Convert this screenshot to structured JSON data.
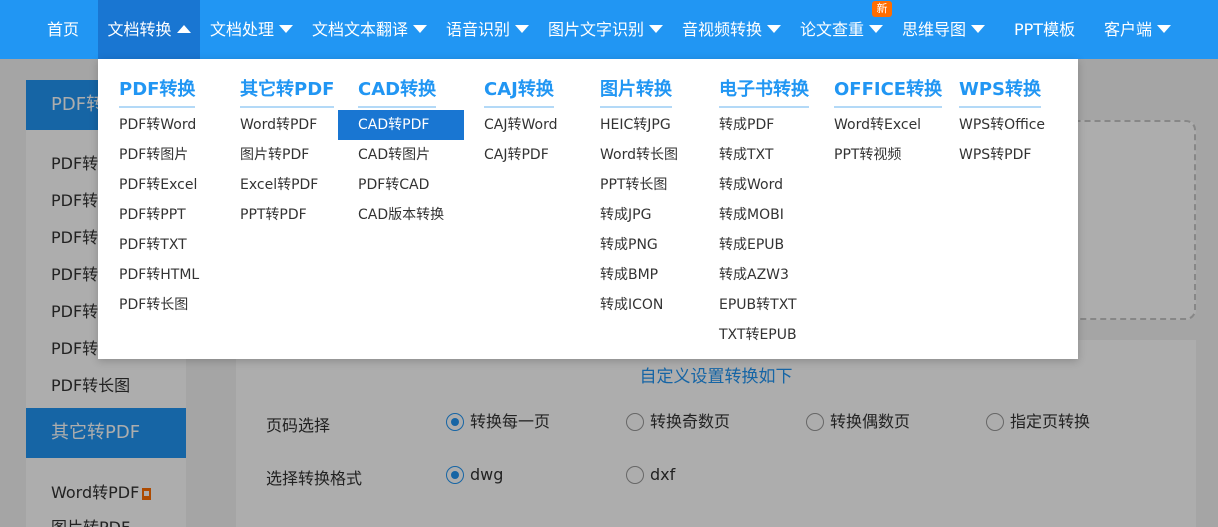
{
  "nav": {
    "items": [
      {
        "label": "首页",
        "caret": false
      },
      {
        "label": "文档转换",
        "caret": true,
        "active": true
      },
      {
        "label": "文档处理",
        "caret": true
      },
      {
        "label": "文档文本翻译",
        "caret": true
      },
      {
        "label": "语音识别",
        "caret": true
      },
      {
        "label": "图片文字识别",
        "caret": true
      },
      {
        "label": "音视频转换",
        "caret": true
      },
      {
        "label": "论文查重",
        "caret": true
      },
      {
        "label": "思维导图",
        "caret": true
      },
      {
        "label": "PPT模板",
        "caret": false
      },
      {
        "label": "客户端",
        "caret": true
      }
    ],
    "new_badge": "新"
  },
  "dropdown": {
    "columns": [
      {
        "title": "PDF转换",
        "items": [
          "PDF转Word",
          "PDF转图片",
          "PDF转Excel",
          "PDF转PPT",
          "PDF转TXT",
          "PDF转HTML",
          "PDF转长图"
        ]
      },
      {
        "title": "其它转PDF",
        "items": [
          "Word转PDF",
          "图片转PDF",
          "Excel转PDF",
          "PPT转PDF"
        ]
      },
      {
        "title": "CAD转换",
        "items": [
          "CAD转PDF",
          "CAD转图片",
          "PDF转CAD",
          "CAD版本转换"
        ],
        "selected": 0
      },
      {
        "title": "CAJ转换",
        "items": [
          "CAJ转Word",
          "CAJ转PDF"
        ]
      },
      {
        "title": "图片转换",
        "items": [
          "HEIC转JPG",
          "Word转长图",
          "PPT转长图",
          "转成JPG",
          "转成PNG",
          "转成BMP",
          "转成ICON"
        ]
      },
      {
        "title": "电子书转换",
        "items": [
          "转成PDF",
          "转成TXT",
          "转成Word",
          "转成MOBI",
          "转成EPUB",
          "转成AZW3",
          "EPUB转TXT",
          "TXT转EPUB"
        ]
      },
      {
        "title": "OFFICE转换",
        "items": [
          "Word转Excel",
          "PPT转视频"
        ]
      },
      {
        "title": "WPS转换",
        "items": [
          "WPS转Office",
          "WPS转PDF"
        ]
      }
    ]
  },
  "sidebar": {
    "group1_title": "PDF转",
    "group1_items": [
      "PDF转",
      "PDF转",
      "PDF转",
      "PDF转",
      "PDF转",
      "PDF转",
      "PDF转长图"
    ],
    "group2_title": "其它转PDF",
    "group2_items": [
      "Word转PDF",
      "图片转PDF"
    ]
  },
  "settings": {
    "title": "自定义设置转换如下",
    "page_label": "页码选择",
    "page_options": [
      "转换每一页",
      "转换奇数页",
      "转换偶数页",
      "指定页转换"
    ],
    "format_label": "选择转换格式",
    "format_options": [
      "dwg",
      "dxf"
    ]
  },
  "colors": {
    "primary": "#2196f3",
    "active": "#1976d2",
    "badge": "#ff6d00"
  }
}
